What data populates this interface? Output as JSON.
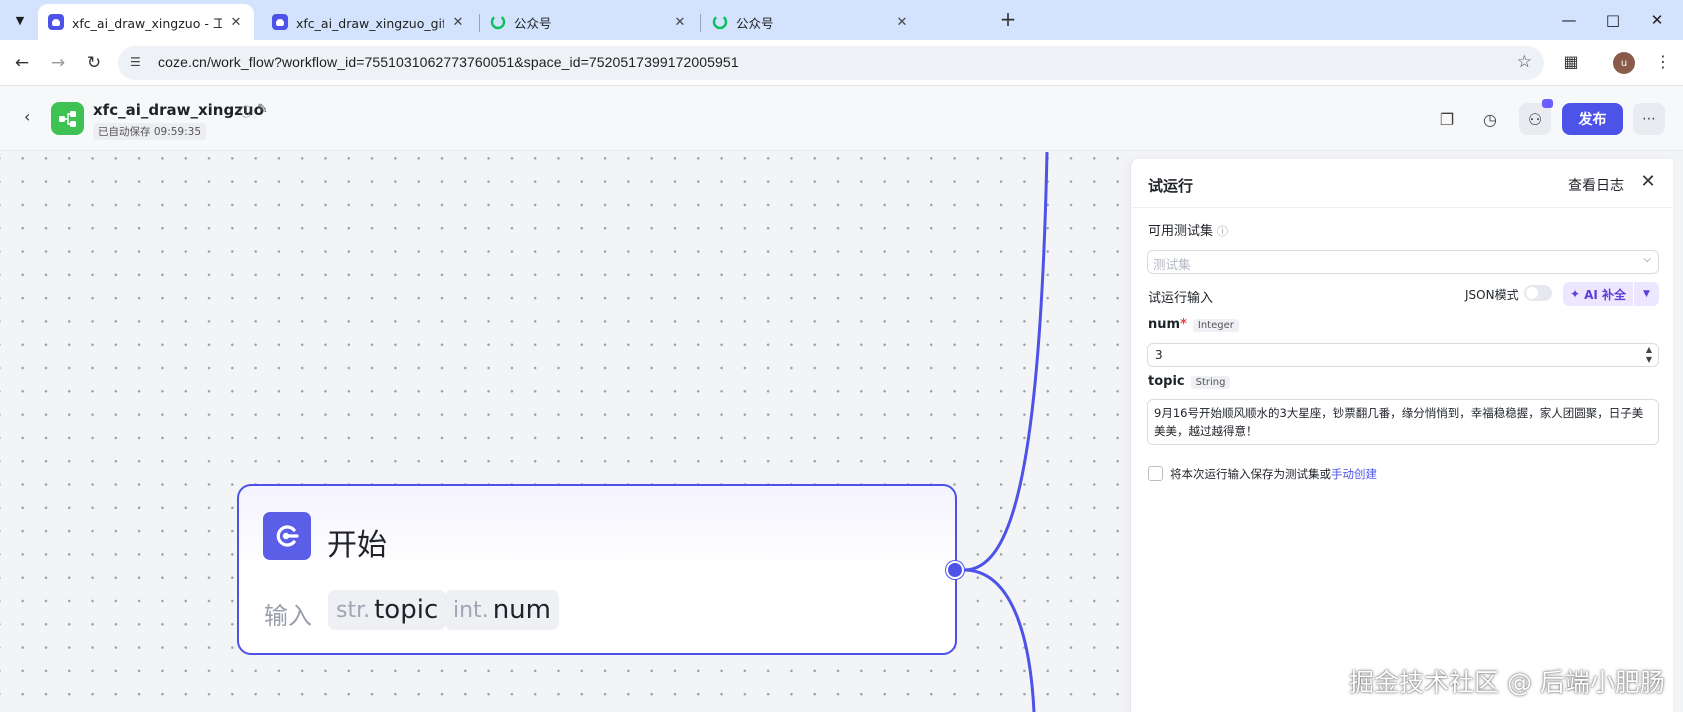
{
  "browser": {
    "tabs": [
      {
        "title": "xfc_ai_draw_xingzuo - 工作流",
        "favicon": "coze-icon",
        "active": true
      },
      {
        "title": "xfc_ai_draw_xingzuo_gif - 工作",
        "favicon": "coze-icon",
        "active": false
      },
      {
        "title": "公众号",
        "favicon": "wechat-gzh-icon",
        "active": false
      },
      {
        "title": "公众号",
        "favicon": "wechat-gzh-icon",
        "active": false
      }
    ],
    "url": "coze.cn/work_flow?workflow_id=7551031062773760051&space_id=7520517399172005951",
    "avatar_letter": "u"
  },
  "header": {
    "workflow_name": "xfc_ai_draw_xingzuo",
    "autosave": "已自动保存 09:59:35",
    "publish_label": "发布"
  },
  "node": {
    "title": "开始",
    "input_label": "输入",
    "params": [
      {
        "type": "str.",
        "name": "topic"
      },
      {
        "type": "int.",
        "name": "num"
      }
    ]
  },
  "panel": {
    "title": "试运行",
    "view_log": "查看日志",
    "testset_label": "可用测试集",
    "testset_placeholder": "测试集",
    "run_input_label": "试运行输入",
    "json_mode_label": "JSON模式",
    "json_mode_on": false,
    "ai_fill_label": "AI 补全",
    "fields": [
      {
        "name": "num",
        "required": true,
        "type": "Integer",
        "value": "3"
      },
      {
        "name": "topic",
        "required": false,
        "type": "String",
        "value": "9月16号开始顺风顺水的3大星座，钞票翻几番，缘分悄悄到，幸福稳稳握，家人团圆聚，日子美美美，越过越得意！"
      }
    ],
    "save_note": "将本次运行输入保存为测试集或",
    "save_link": "手动创建"
  },
  "watermark": "掘金技术社区 @ 后端小肥肠",
  "colors": {
    "accent": "#4d53e8",
    "logo_green": "#3ec254",
    "ai_purple": "#5a3fd8",
    "tabstrip": "#d3e3fd"
  }
}
